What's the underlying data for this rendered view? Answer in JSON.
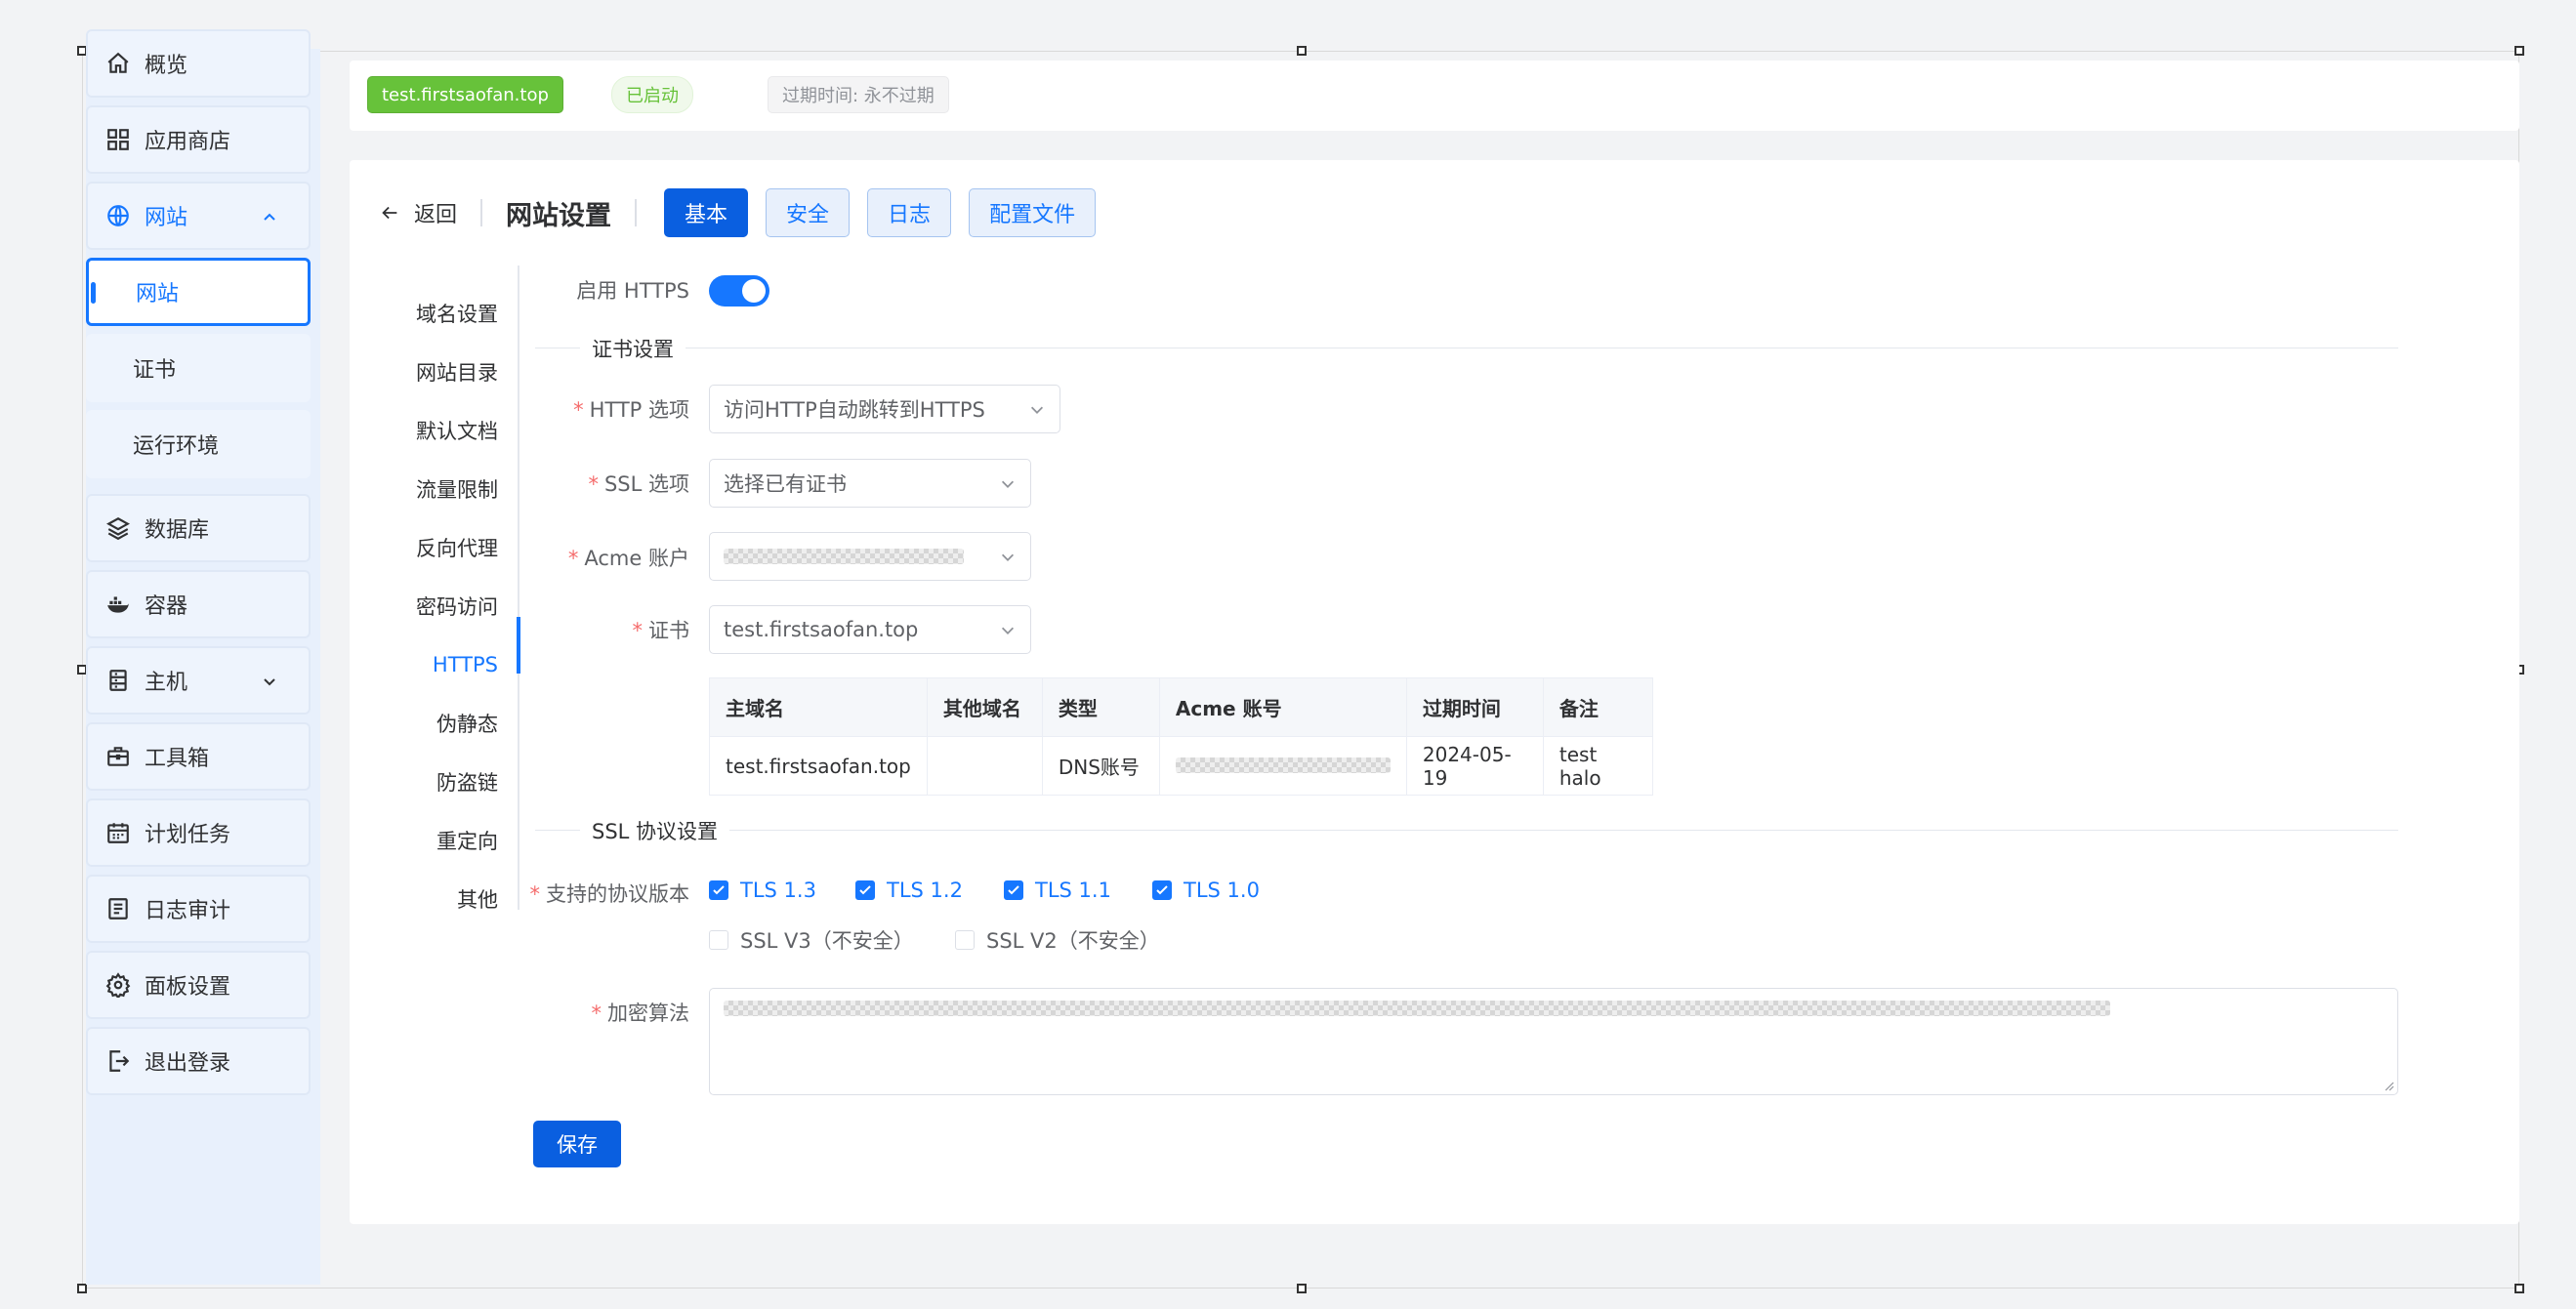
{
  "sidebar": {
    "items": [
      {
        "label": "概览",
        "icon": "home-icon"
      },
      {
        "label": "应用商店",
        "icon": "grid-icon"
      },
      {
        "label": "网站",
        "icon": "globe-icon"
      },
      {
        "label": "数据库",
        "icon": "layers-icon"
      },
      {
        "label": "容器",
        "icon": "docker-icon"
      },
      {
        "label": "主机",
        "icon": "server-icon"
      },
      {
        "label": "工具箱",
        "icon": "toolbox-icon"
      },
      {
        "label": "计划任务",
        "icon": "calendar-icon"
      },
      {
        "label": "日志审计",
        "icon": "log-icon"
      },
      {
        "label": "面板设置",
        "icon": "gear-icon"
      },
      {
        "label": "退出登录",
        "icon": "logout-icon"
      }
    ],
    "website_sub": [
      "网站",
      "证书",
      "运行环境"
    ]
  },
  "topbar": {
    "domain": "test.firstsaofan.top",
    "status": "已启动",
    "expire": "过期时间: 永不过期"
  },
  "header": {
    "back": "返回",
    "title": "网站设置",
    "tabs": [
      "基本",
      "安全",
      "日志",
      "配置文件"
    ]
  },
  "menu": [
    "域名设置",
    "网站目录",
    "默认文档",
    "流量限制",
    "反向代理",
    "密码访问",
    "HTTPS",
    "伪静态",
    "防盗链",
    "重定向",
    "其他"
  ],
  "form": {
    "https_label": "启用 HTTPS",
    "cert_section": "证书设置",
    "http_option_label": "HTTP 选项",
    "http_option_value": "访问HTTP自动跳转到HTTPS",
    "ssl_option_label": "SSL 选项",
    "ssl_option_value": "选择已有证书",
    "acme_label": "Acme 账户",
    "cert_label": "证书",
    "cert_value": "test.firstsaofan.top",
    "ssl_protocol_section": "SSL 协议设置",
    "protocol_label": "支持的协议版本",
    "protocols_checked": [
      "TLS 1.3",
      "TLS 1.2",
      "TLS 1.1",
      "TLS 1.0"
    ],
    "protocols_unchecked": [
      "SSL V3（不安全）",
      "SSL V2（不安全）"
    ],
    "cipher_label": "加密算法",
    "save": "保存"
  },
  "cert_table": {
    "headers": [
      "主域名",
      "其他域名",
      "类型",
      "Acme 账号",
      "过期时间",
      "备注"
    ],
    "row": [
      "test.firstsaofan.top",
      "",
      "DNS账号",
      "",
      "2024-05-19",
      "test halo"
    ]
  },
  "colors": {
    "primary": "#1677ff",
    "success": "#67c23a",
    "danger": "#f56c6c"
  }
}
